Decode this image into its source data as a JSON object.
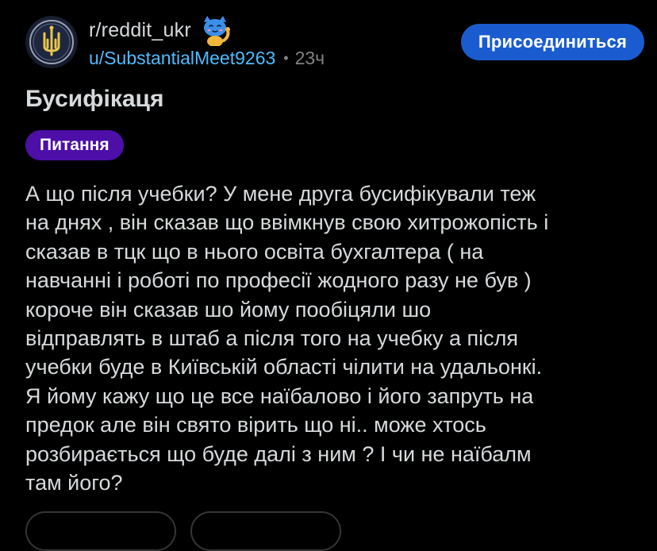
{
  "post": {
    "subreddit": "r/reddit_ukr",
    "author": "u/SubstantialMeet9263",
    "separator": "•",
    "age": "23ч",
    "join_label": "Присоединиться",
    "title": "Бусифікаця",
    "flair": "Питання",
    "body": "А що після учебки? У мене друга бусифікували теж\nна днях , він сказав що ввімкнув свою хитрожопість і\nсказав в тцк що в нього освіта бухгалтера ( на\nнавчанні і роботі по професії жодного разу не був )\nкороче він сказав шо йому пообіцяли шо\nвідправлять в штаб а після того на учебку а після\nучебки буде в Київській області чілити на удальонкі.\nЯ йому кажу що це все наїбалово і його запруть на\nпредок але він свято вірить що ні.. може хтось\nрозбирається що буде далі з ним ? І чи не наїбалм\nтам його?"
  },
  "icons": {
    "avatar": "subreddit-trident-emblem",
    "snoo": "cat-snoo-waving-icon"
  },
  "colors": {
    "background": "#000000",
    "username": "#4fbcff",
    "join_button": "#1a5ccf",
    "flair": "#4d0fa8"
  }
}
